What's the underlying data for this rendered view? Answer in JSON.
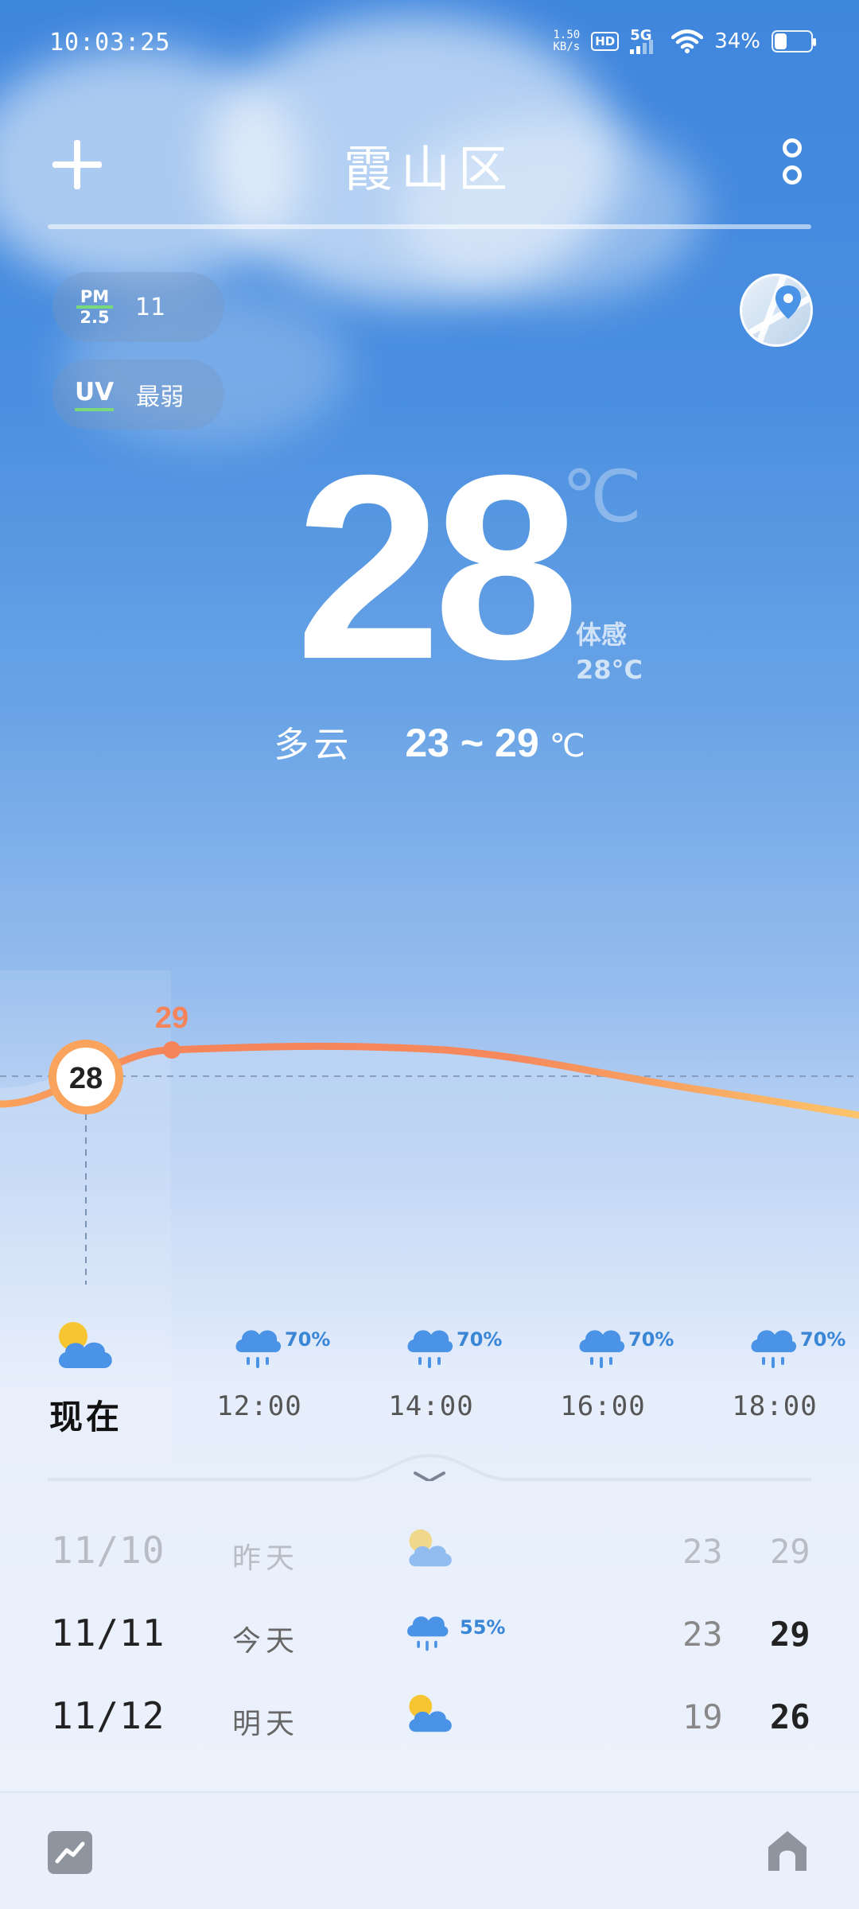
{
  "status_bar": {
    "time": "10:03:25",
    "net_speed_value": "1.50",
    "net_speed_unit": "KB/s",
    "hd": "HD",
    "network": "5G",
    "battery_percent": "34%",
    "battery_level": 0.34
  },
  "header": {
    "city": "霞山区"
  },
  "air": {
    "pm_label_top": "PM",
    "pm_label_bottom": "2.5",
    "pm_value": "11",
    "uv_label": "UV",
    "uv_value": "最弱"
  },
  "current": {
    "temperature": "28",
    "unit": "℃",
    "feels_label": "体感",
    "feels_value": "28°C",
    "condition": "多云",
    "range": "23 ~ 29",
    "range_unit": "℃"
  },
  "hourly_chart": {
    "current_label": "28",
    "peak_label": "29"
  },
  "hourly": [
    {
      "time": "现在",
      "icon": "partly-cloudy-icon",
      "pop": ""
    },
    {
      "time": "12:00",
      "icon": "rain-cloud-icon",
      "pop": "70%"
    },
    {
      "time": "14:00",
      "icon": "rain-cloud-icon",
      "pop": "70%"
    },
    {
      "time": "16:00",
      "icon": "rain-cloud-icon",
      "pop": "70%"
    },
    {
      "time": "18:00",
      "icon": "rain-cloud-icon",
      "pop": "70%"
    }
  ],
  "daily": [
    {
      "date": "11/10",
      "name": "昨天",
      "icon": "partly-cloudy-icon",
      "pop": "",
      "low": "23",
      "high": "29",
      "past": true
    },
    {
      "date": "11/11",
      "name": "今天",
      "icon": "rain-cloud-icon",
      "pop": "55%",
      "low": "23",
      "high": "29",
      "past": false
    },
    {
      "date": "11/12",
      "name": "明天",
      "icon": "partly-cloudy-icon",
      "pop": "",
      "low": "19",
      "high": "26",
      "past": false
    }
  ],
  "colors": {
    "accent_orange": "#f5845a",
    "rain_blue": "#3a86d6",
    "sun_yellow": "#f7c531"
  }
}
